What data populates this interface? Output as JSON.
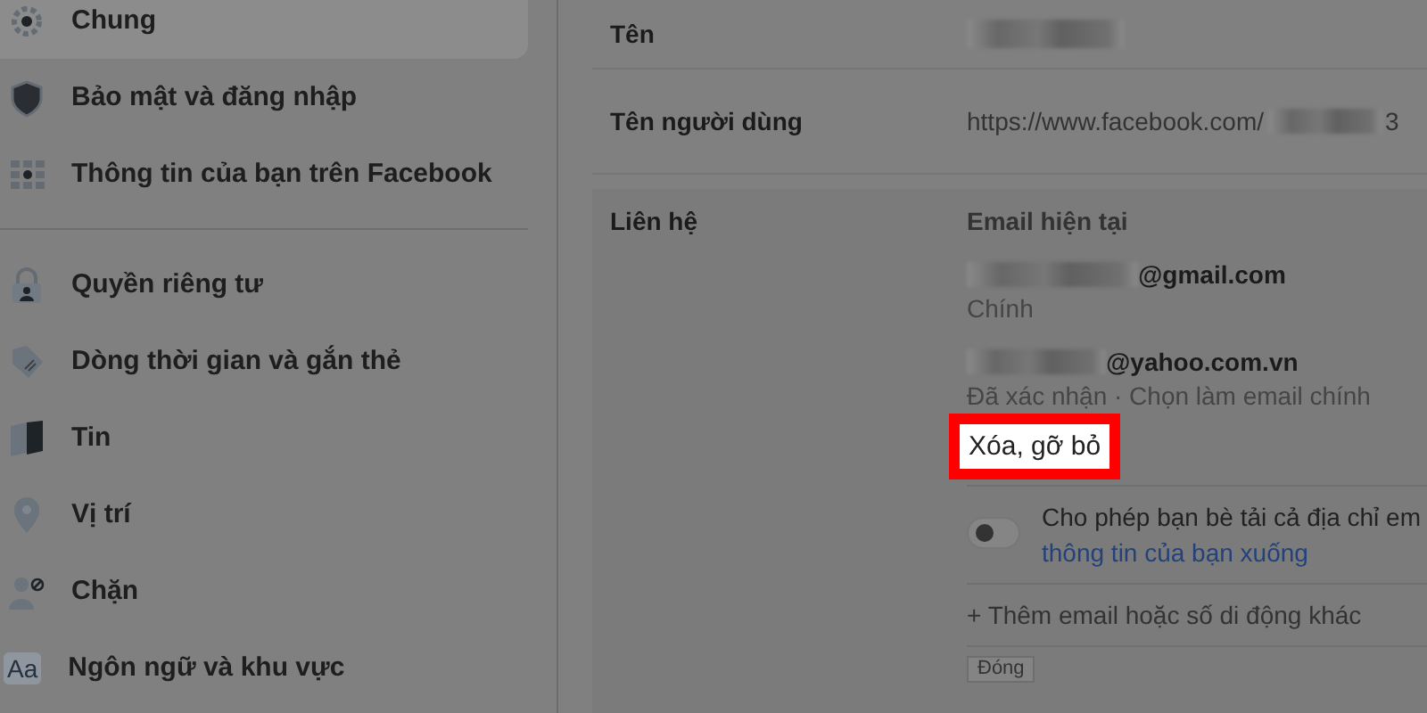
{
  "sidebar": {
    "groups": [
      [
        {
          "label": "Chung",
          "kind": "gear",
          "selected": true
        },
        {
          "label": "Bảo mật và đăng nhập",
          "kind": "shield",
          "selected": false
        },
        {
          "label": "Thông tin của bạn trên Facebook",
          "kind": "grid",
          "selected": false
        }
      ],
      [
        {
          "label": "Quyền riêng tư",
          "kind": "lock",
          "selected": false
        },
        {
          "label": "Dòng thời gian và gắn thẻ",
          "kind": "tag",
          "selected": false
        },
        {
          "label": "Tin",
          "kind": "book",
          "selected": false
        },
        {
          "label": "Vị trí",
          "kind": "pin",
          "selected": false
        },
        {
          "label": "Chặn",
          "kind": "block",
          "selected": false
        },
        {
          "label": "Ngôn ngữ và khu vực",
          "kind": "glyph",
          "glyph": "Aa",
          "selected": false
        }
      ]
    ]
  },
  "settings": {
    "rows": [
      {
        "label": "Tên",
        "kind": "redacted"
      },
      {
        "label": "Tên người dùng",
        "kind": "url",
        "value": "https://www.facebook.com/",
        "suffix": "3"
      }
    ],
    "contact": {
      "label": "Liên hệ",
      "heading": "Email hiện tại",
      "emails": [
        {
          "address": "@gmail.com",
          "status": "Chính"
        },
        {
          "address": "@yahoo.com.vn",
          "status": "Đã xác nhận · Chọn làm email chính",
          "remove": "Xóa, gỡ bỏ",
          "highlighted": true
        }
      ],
      "toggle": {
        "on": false,
        "text": "Cho phép bạn bè tải cả địa chỉ em",
        "link": "thông tin của bạn xuống"
      },
      "add_link": "+ Thêm email hoặc số di động khác",
      "close_button": "Đóng"
    }
  }
}
